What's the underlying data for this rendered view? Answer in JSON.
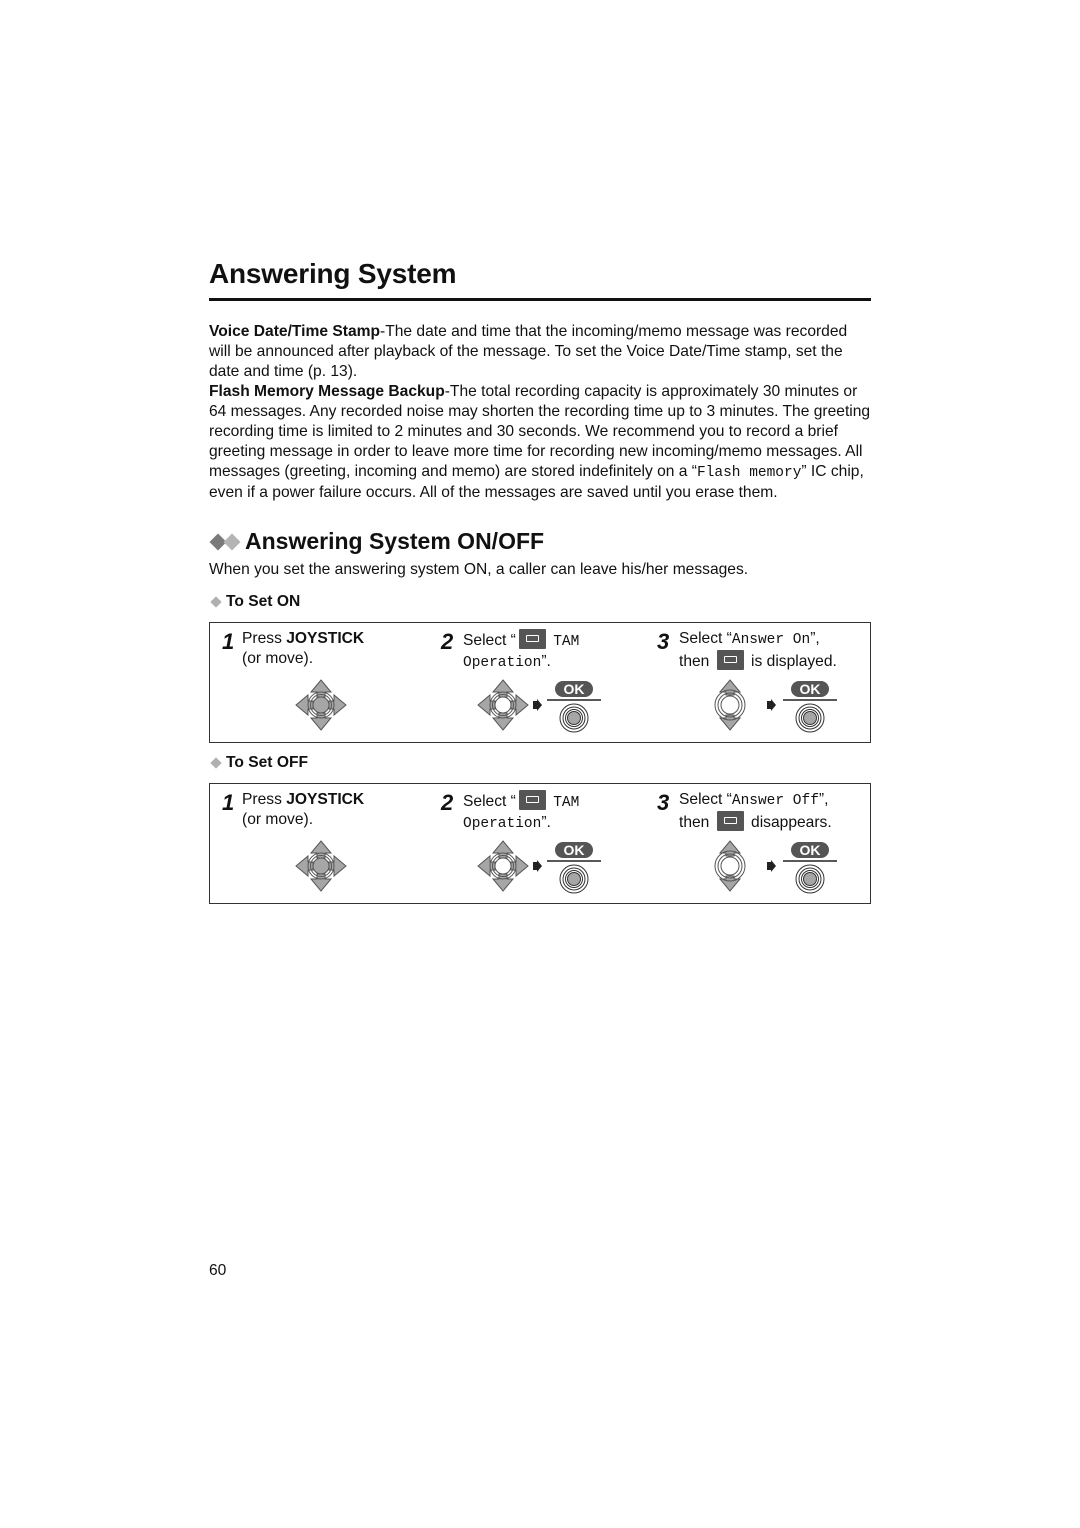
{
  "page": {
    "title": "Answering System",
    "page_number": "60"
  },
  "paragraphs": {
    "voice_stamp": {
      "label": "Voice Date/Time Stamp",
      "text": "-The date and time that the incoming/memo message was recorded will be announced after playback of the message. To set the Voice Date/Time stamp, set the date and time (p. 13)."
    },
    "flash_backup": {
      "label": "Flash Memory Message Backup",
      "text_before": "-The total recording capacity is approximately 30 minutes or 64 messages. Any recorded noise may shorten the recording time up to 3 minutes. The greeting recording time is limited to 2 minutes and 30 seconds. We recommend you to record a brief greeting message in order to leave more time for recording new incoming/memo messages. All messages (greeting, incoming and memo) are stored indefinitely on a “",
      "mono": "Flash memory",
      "text_after": "” IC chip, even if a power failure occurs. All of the messages are saved until you erase them."
    }
  },
  "section": {
    "title": "Answering System ON/OFF",
    "intro": "When you set the answering system ON, a caller can leave his/her messages."
  },
  "set_on": {
    "heading": "To Set ON",
    "steps": [
      {
        "num": "1",
        "pre": "Press ",
        "bold": "JOYSTICK",
        "line2": "(or move).",
        "icon": "joystick-4way-icon"
      },
      {
        "num": "2",
        "pre": "Select “",
        "mono1": "TAM",
        "mono2": "Operation",
        "post": "”.",
        "icon": "joystick-4way-icon",
        "button": "OK"
      },
      {
        "num": "3",
        "pre": "Select “",
        "mono1": "Answer On",
        "post": "”,",
        "line2_pre": "then",
        "line2_post": "is displayed.",
        "icon": "joystick-updown-icon",
        "button": "OK"
      }
    ]
  },
  "set_off": {
    "heading": "To Set OFF",
    "steps": [
      {
        "num": "1",
        "pre": "Press ",
        "bold": "JOYSTICK",
        "line2": "(or move).",
        "icon": "joystick-4way-icon"
      },
      {
        "num": "2",
        "pre": "Select “",
        "mono1": "TAM",
        "mono2": "Operation",
        "post": "”.",
        "icon": "joystick-4way-icon",
        "button": "OK"
      },
      {
        "num": "3",
        "pre": "Select “",
        "mono1": "Answer Off",
        "post": "”,",
        "line2_pre": "then",
        "line2_post": "disappears.",
        "icon": "joystick-updown-icon",
        "button": "OK"
      }
    ]
  },
  "colors": {
    "text": "#111111",
    "icon_gray": "#a6a6a6",
    "icon_dark": "#555555"
  }
}
